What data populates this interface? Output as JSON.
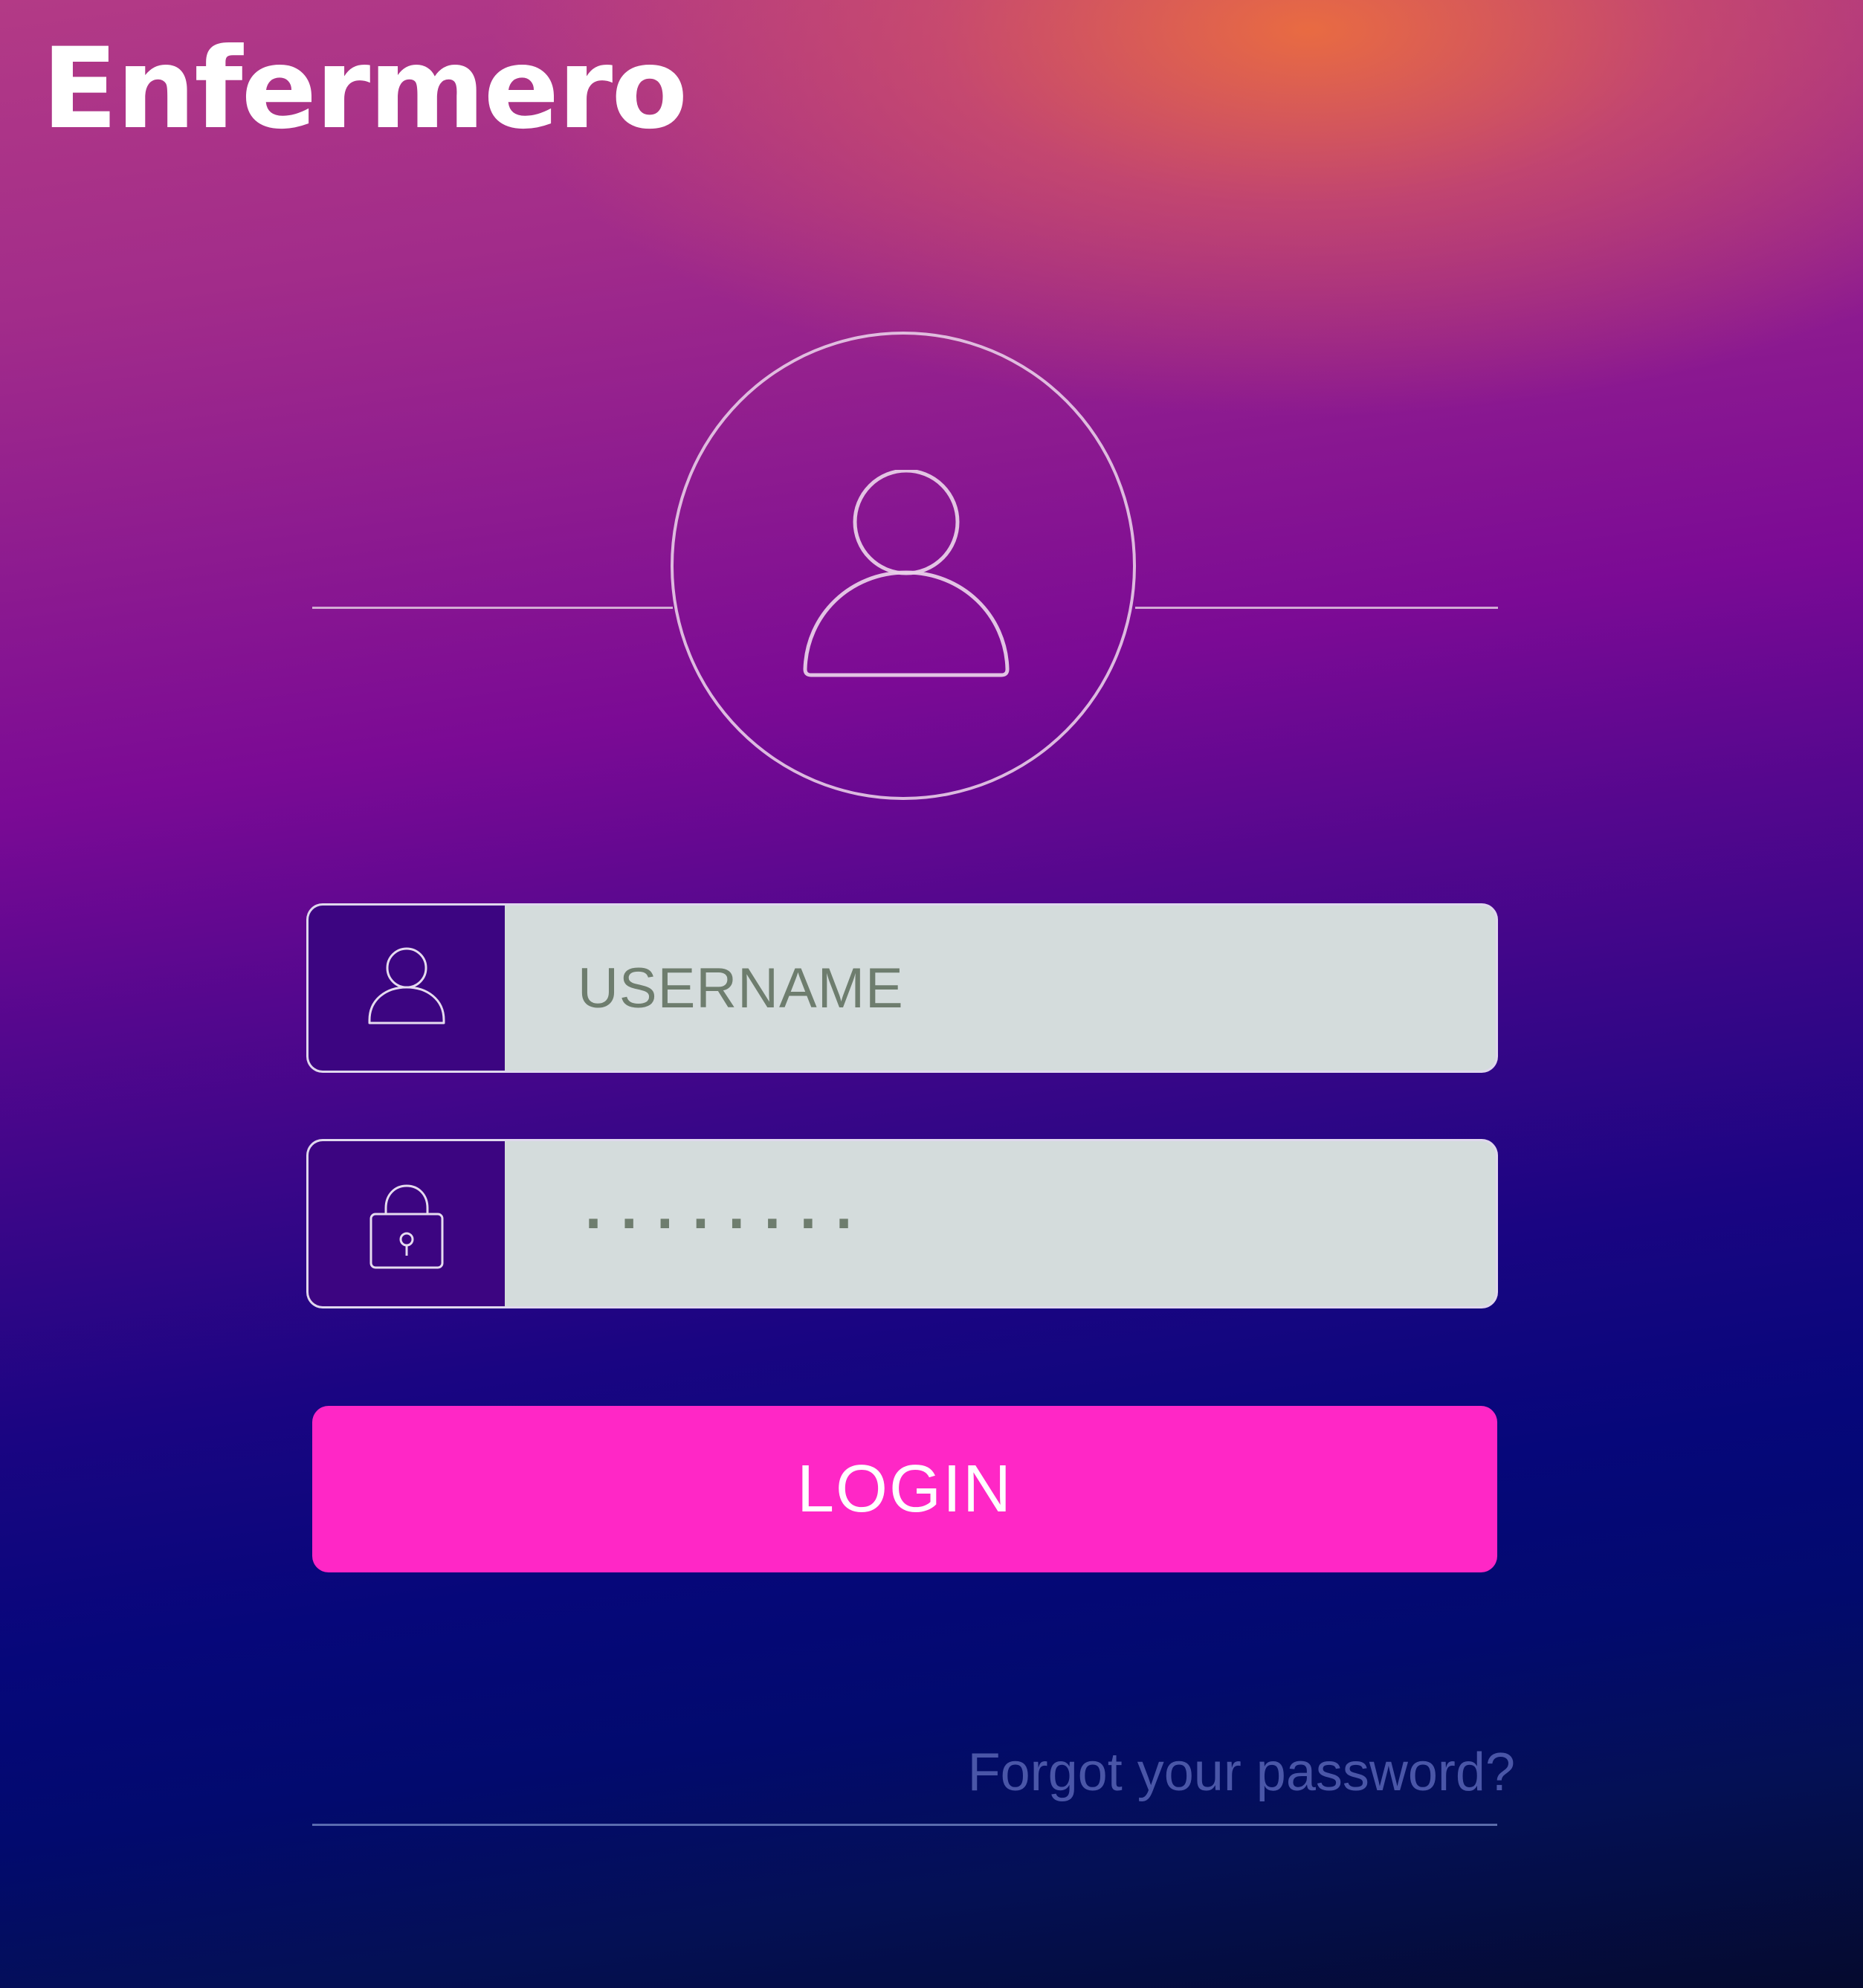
{
  "app": {
    "title": "Enfermero"
  },
  "login_form": {
    "username": {
      "icon": "user-icon",
      "placeholder": "USERNAME"
    },
    "password": {
      "icon": "lock-icon",
      "masked_value": "........"
    },
    "submit_label": "LOGIN",
    "forgot_password_label": "Forgot your password?"
  },
  "avatar": {
    "icon": "user-avatar-icon"
  },
  "colors": {
    "accent": "#ff27c6",
    "input_background": "#d4dcdc",
    "icon_box_background": "#3c0581",
    "text_on_input": "#6e7d6e",
    "link": "#4a56a8"
  }
}
